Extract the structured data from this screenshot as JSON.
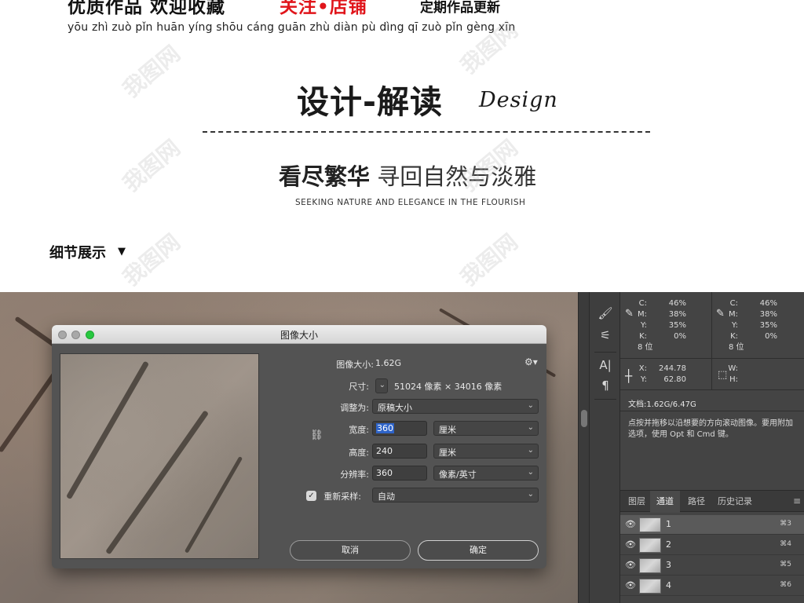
{
  "banner": {
    "header_black": "优质作品 欢迎收藏",
    "header_red": "关注•店铺",
    "header_update": "定期作品更新",
    "pinyin": "yōu zhì zuò pǐn huān yíng shōu cáng guān zhù diàn pù dìng qī zuò pǐn gèng xīn",
    "design_title": "设计-解读",
    "design_en": "Design",
    "tagline_bold": "看尽繁华",
    "tagline_thin": "寻回自然与淡雅",
    "tagline_en": "SEEKING NATURE AND ELEGANCE IN THE FLOURISH",
    "detail_heading": "细节展示",
    "detail_arrow": "▼",
    "watermark": "我图网"
  },
  "colors": {
    "accent_red": "#e0151b",
    "selection_blue": "#2e64c9",
    "ps_panel": "#444444",
    "traffic_green": "#28c840"
  },
  "dialog": {
    "title": "图像大小",
    "image_size_label": "图像大小:",
    "image_size_value": "1.62G",
    "dimensions_label": "尺寸:",
    "dimensions_value": "51024 像素  ×  34016 像素",
    "fit_label": "调整为:",
    "fit_value": "原稿大小",
    "width_label": "宽度:",
    "width_value": "360",
    "width_unit": "厘米",
    "height_label": "高度:",
    "height_value": "240",
    "height_unit": "厘米",
    "resolution_label": "分辨率:",
    "resolution_value": "360",
    "resolution_unit": "像素/英寸",
    "resample_label": "重新采样:",
    "resample_value": "自动",
    "cancel_label": "取消",
    "ok_label": "确定",
    "icons": {
      "gear": "gear-icon",
      "chain": "chain-link-icon",
      "chevron": "chevron-down-icon",
      "check": "checkmark-icon"
    }
  },
  "info_panel": {
    "left": {
      "c": "46%",
      "m": "38%",
      "y": "35%",
      "k": "0%",
      "bits": "8 位"
    },
    "right": {
      "c": "46%",
      "m": "38%",
      "y": "35%",
      "k": "0%",
      "bits": "8 位"
    },
    "labels": {
      "c": "C:",
      "m": "M:",
      "y": "Y:",
      "k": "K:",
      "x": "X:",
      "yy": "Y:",
      "w": "W:",
      "h": "H:"
    },
    "x_value": "244.78",
    "y_value": "62.80",
    "doc": "文档:1.62G/6.47G",
    "hint": "点按并拖移以沿想要的方向滚动图像。要用附加选项，使用 Opt 和 Cmd 键。"
  },
  "tabs": [
    "图层",
    "通道",
    "路径",
    "历史记录"
  ],
  "channels": [
    {
      "name": "1",
      "key": "⌘3"
    },
    {
      "name": "2",
      "key": "⌘4"
    },
    {
      "name": "3",
      "key": "⌘5"
    },
    {
      "name": "4",
      "key": "⌘6"
    }
  ]
}
